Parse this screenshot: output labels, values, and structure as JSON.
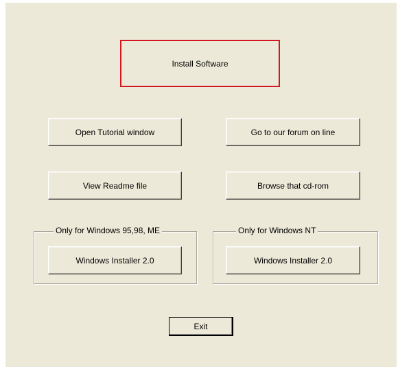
{
  "main": {
    "install_label": "Install Software",
    "tutorial_label": "Open Tutorial window",
    "forum_label": "Go to our forum on line",
    "readme_label": "View Readme file",
    "browse_label": "Browse that cd-rom",
    "exit_label": "Exit"
  },
  "groups": {
    "win9x": {
      "legend": "Only for Windows 95,98, ME",
      "installer_label": "Windows Installer 2.0"
    },
    "winnt": {
      "legend": "Only for Windows NT",
      "installer_label": "Windows Installer 2.0"
    }
  },
  "colors": {
    "background": "#ece9d8",
    "install_highlight_border": "#d4181f"
  }
}
